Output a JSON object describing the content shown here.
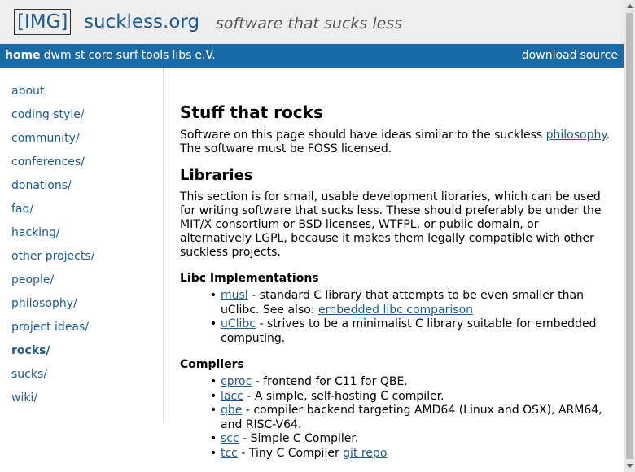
{
  "header": {
    "logo_text": "[IMG]",
    "site_name": "suckless.org",
    "tagline": "software that sucks less"
  },
  "menu": {
    "left": [
      "home",
      "dwm",
      "st",
      "core",
      "surf",
      "tools",
      "libs",
      "e.V."
    ],
    "right": [
      "download",
      "source"
    ]
  },
  "sidebar": {
    "items": [
      {
        "label": "about"
      },
      {
        "label": "coding style/"
      },
      {
        "label": "community/"
      },
      {
        "label": "conferences/"
      },
      {
        "label": "donations/"
      },
      {
        "label": "faq/"
      },
      {
        "label": "hacking/"
      },
      {
        "label": "other projects/"
      },
      {
        "label": "people/"
      },
      {
        "label": "philosophy/"
      },
      {
        "label": "project ideas/"
      },
      {
        "label": "rocks/"
      },
      {
        "label": "sucks/"
      },
      {
        "label": "wiki/"
      }
    ],
    "current": "rocks/"
  },
  "main": {
    "title": "Stuff that rocks",
    "intro_before": "Software on this page should have ideas similar to the suckless ",
    "intro_link": "philosophy",
    "intro_after": ". The software must be FOSS licensed.",
    "libraries_heading": "Libraries",
    "libraries_text": "This section is for small, usable development libraries, which can be used for writing software that sucks less. These should preferably be under the MIT/X consortium or BSD licenses, WTFPL, or public domain, or alternatively LGPL, because it makes them legally compatible with other suckless projects.",
    "libc_heading": "Libc Implementations",
    "libc_items": [
      {
        "link": "musl",
        "text": " - standard C library that attempts to be even smaller than uClibc. See also: ",
        "link2": "embedded libc comparison"
      },
      {
        "link": "uClibc",
        "text": " - strives to be a minimalist C library suitable for embedded computing."
      }
    ],
    "compilers_heading": "Compilers",
    "compiler_items": [
      {
        "link": "cproc",
        "text": " - frontend for C11 for QBE."
      },
      {
        "link": "lacc",
        "text": " - A simple, self-hosting C compiler."
      },
      {
        "link": "qbe",
        "text": " - compiler backend targeting AMD64 (Linux and OSX), ARM64, and RISC-V64."
      },
      {
        "link": "scc",
        "text": " - Simple C Compiler."
      },
      {
        "link": "tcc",
        "text": " - Tiny C Compiler ",
        "link2": "git repo"
      }
    ]
  }
}
